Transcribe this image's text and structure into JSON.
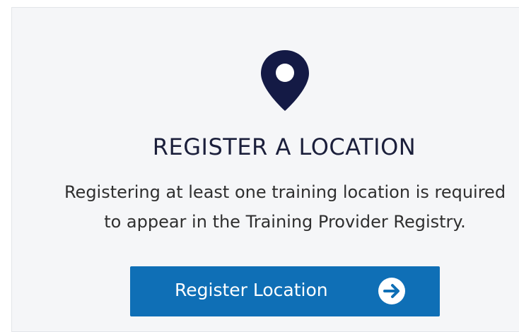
{
  "card": {
    "icon": "map-pin-icon",
    "title": "REGISTER A LOCATION",
    "description_line1": "Registering at least one training location is required",
    "description_line2": "to appear in the Training Provider Registry.",
    "button_label": "Register Location",
    "button_icon": "arrow-right-circle-icon"
  },
  "colors": {
    "card_bg": "#f5f6f8",
    "title": "#1b1f3b",
    "pin": "#141a45",
    "button_bg": "#0f6fb6",
    "button_text": "#ffffff"
  }
}
